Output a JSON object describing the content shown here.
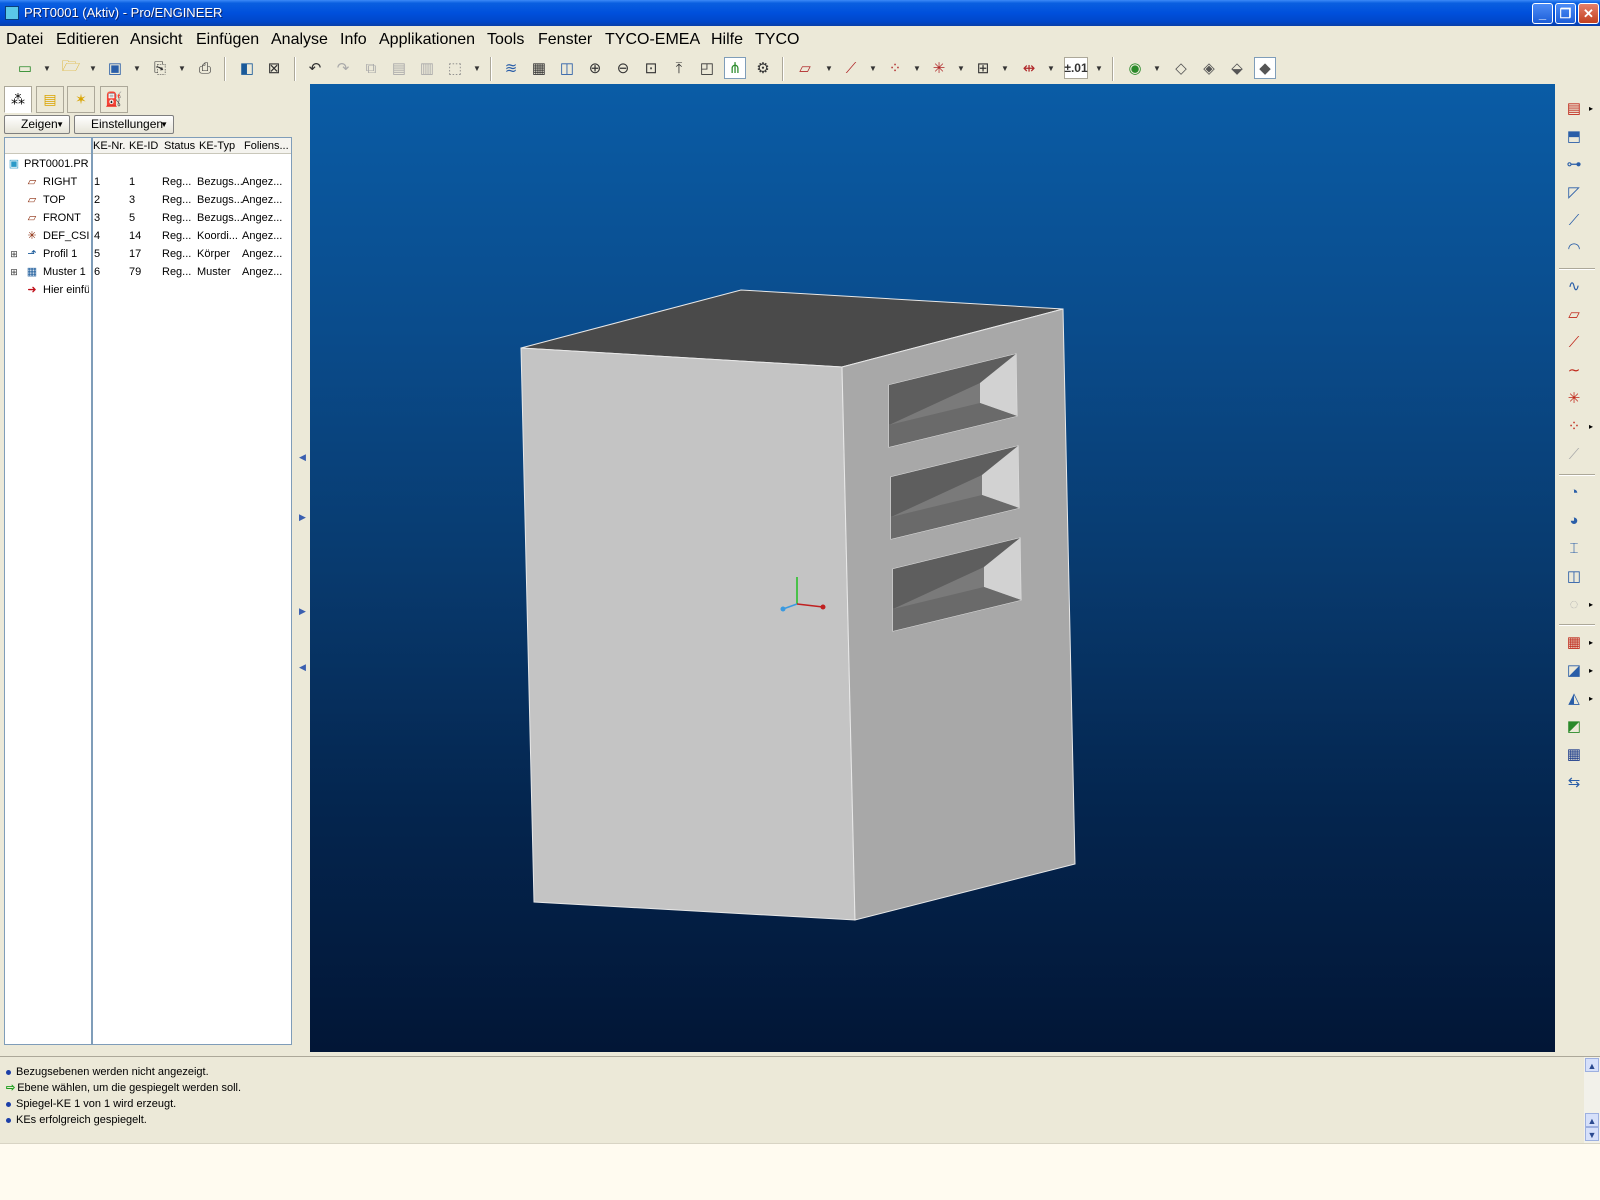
{
  "window": {
    "title": "PRT0001 (Aktiv) - Pro/ENGINEER",
    "minimize_label": "_",
    "maximize_label": "❐",
    "close_label": "✕"
  },
  "menu": [
    "Datei",
    "Editieren",
    "Ansicht",
    "Einfügen",
    "Analyse",
    "Info",
    "Applikationen",
    "Tools",
    "Fenster",
    "TYCO-EMEA",
    "Hilfe",
    "TYCO"
  ],
  "toolbar": {
    "tolerance_label": "±.01"
  },
  "left_panel": {
    "show_button": "Zeigen",
    "settings_button": "Einstellungen",
    "columns": [
      "KE-Nr.",
      "KE-ID",
      "Status",
      "KE-Typ",
      "Foliens..."
    ],
    "rows": [
      {
        "name": "PRT0001.PR",
        "nr": "",
        "id": "",
        "status": "",
        "type": "",
        "layer": ""
      },
      {
        "name": "RIGHT",
        "nr": "1",
        "id": "1",
        "status": "Reg...",
        "type": "Bezugs...",
        "layer": "Angez..."
      },
      {
        "name": "TOP",
        "nr": "2",
        "id": "3",
        "status": "Reg...",
        "type": "Bezugs...",
        "layer": "Angez..."
      },
      {
        "name": "FRONT",
        "nr": "3",
        "id": "5",
        "status": "Reg...",
        "type": "Bezugs...",
        "layer": "Angez..."
      },
      {
        "name": "DEF_CSI",
        "nr": "4",
        "id": "14",
        "status": "Reg...",
        "type": "Koordi...",
        "layer": "Angez..."
      },
      {
        "name": "Profil 1",
        "nr": "5",
        "id": "17",
        "status": "Reg...",
        "type": "Körper",
        "layer": "Angez..."
      },
      {
        "name": "Muster 1",
        "nr": "6",
        "id": "79",
        "status": "Reg...",
        "type": "Muster",
        "layer": "Angez..."
      },
      {
        "name": "Hier einfü",
        "nr": "",
        "id": "",
        "status": "",
        "type": "",
        "layer": ""
      }
    ]
  },
  "messages": [
    "Bezugsebenen werden nicht angezeigt.",
    "Ebene wählen, um die gespiegelt werden soll.",
    "Spiegel-KE 1 von 1 wird erzeugt.",
    "KEs erfolgreich gespiegelt."
  ],
  "colors": {
    "viewport_top": "#0a5ca6",
    "viewport_bottom": "#021636",
    "part_front": "#c4c4c4",
    "part_side": "#a8a8a8",
    "part_top": "#4a4a4a"
  }
}
